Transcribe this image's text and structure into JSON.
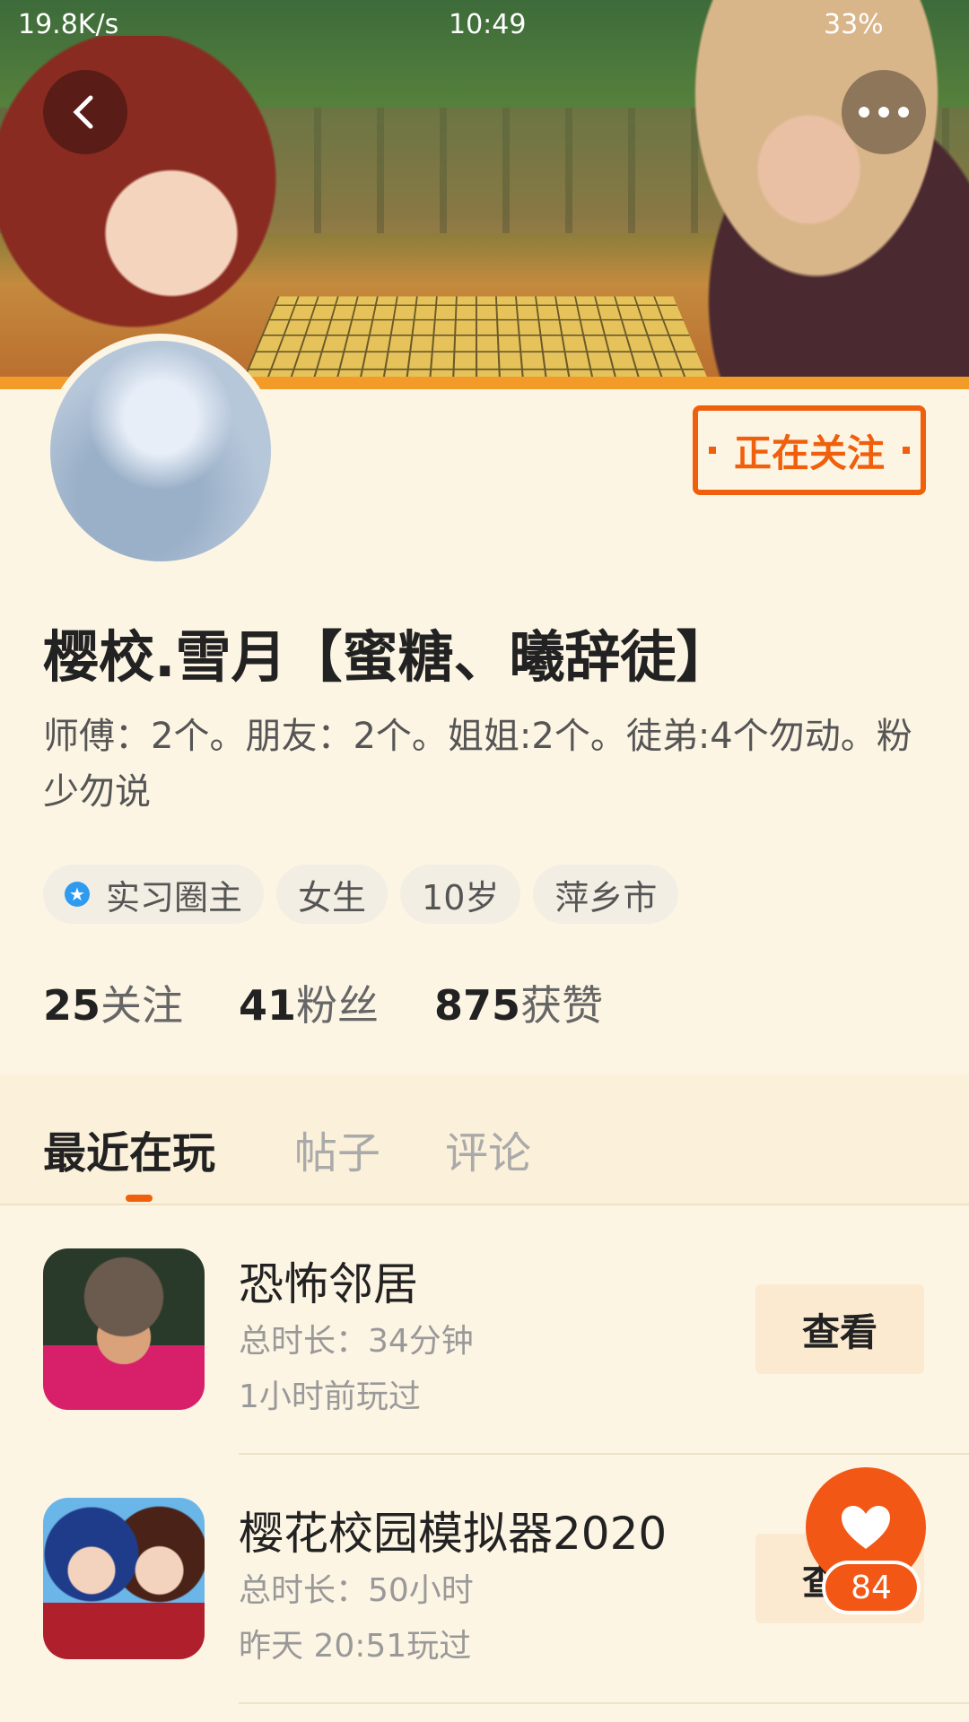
{
  "status_bar": {
    "speed": "19.8K/s",
    "time": "10:49",
    "battery": "33%"
  },
  "profile": {
    "follow_label": "正在关注",
    "username": "樱校.雪月【蜜糖、曦辞徒】",
    "bio": "师傅：2个。朋友：2个。姐姐:2个。徒弟:4个勿动。粉少勿说",
    "tags": [
      "实习圈主",
      "女生",
      "10岁",
      "萍乡市"
    ],
    "stats": [
      {
        "num": "25",
        "label": "关注"
      },
      {
        "num": "41",
        "label": "粉丝"
      },
      {
        "num": "875",
        "label": "获赞"
      }
    ]
  },
  "tabs": [
    "最近在玩",
    "帖子",
    "评论"
  ],
  "games": [
    {
      "title": "恐怖邻居",
      "duration": "总时长：34分钟",
      "last": "1小时前玩过",
      "button": "查看"
    },
    {
      "title": "樱花校园模拟器2020",
      "duration": "总时长：50小时",
      "last": "昨天 20:51玩过",
      "button": "查看"
    }
  ],
  "like": {
    "count": "84"
  },
  "icons": {
    "back": "back-arrow-icon",
    "more": "more-dots-icon",
    "like": "heart-icon",
    "verified": "verified-badge-icon"
  },
  "colors": {
    "accent": "#f0600c",
    "background": "#fdf5e4"
  }
}
